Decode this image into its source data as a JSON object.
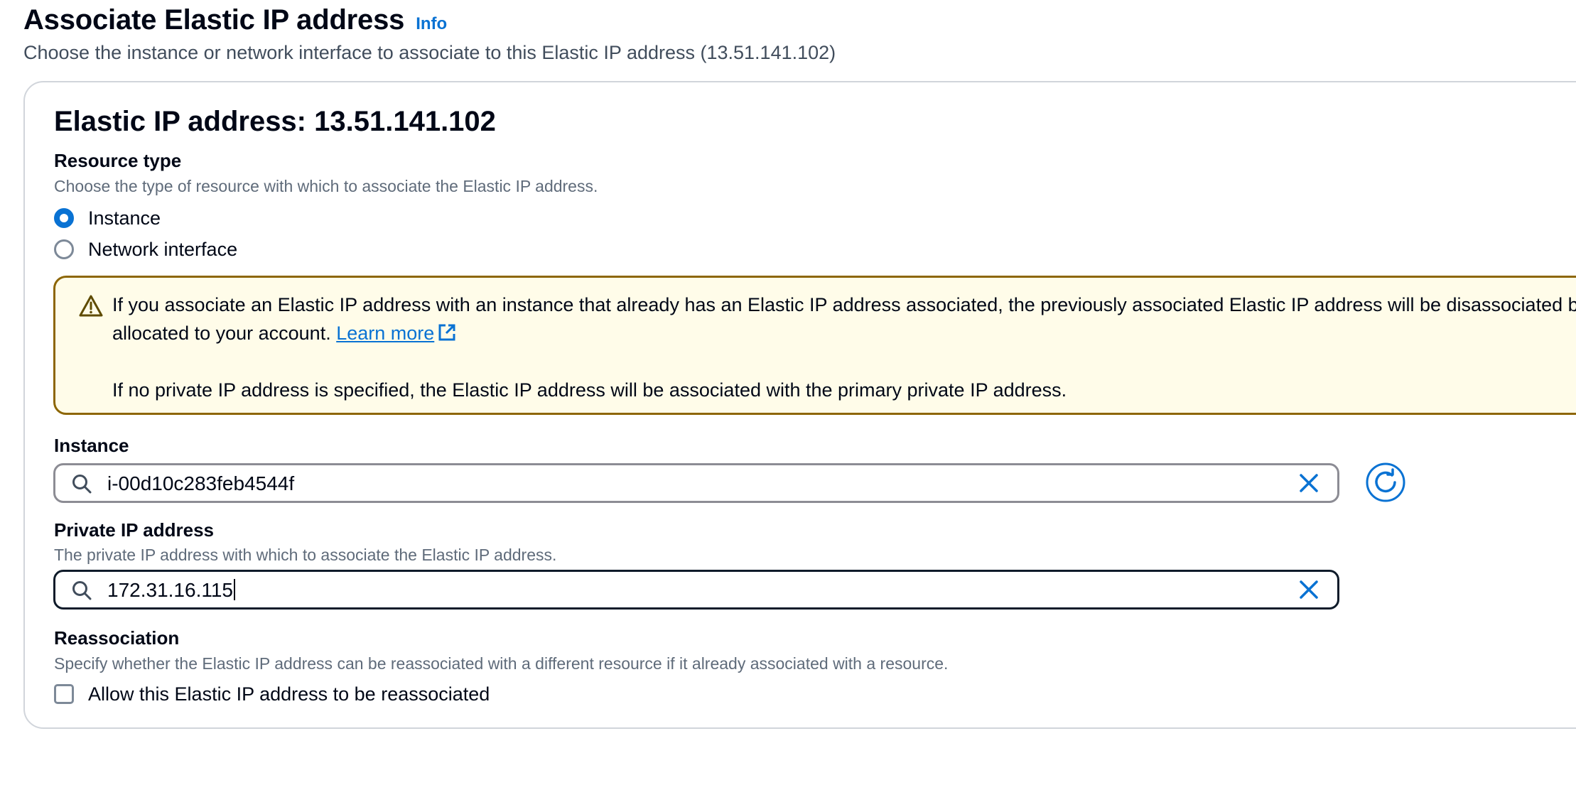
{
  "header": {
    "title": "Associate Elastic IP address",
    "info_label": "Info",
    "description": "Choose the instance or network interface to associate to this Elastic IP address (13.51.141.102)"
  },
  "card": {
    "title": "Elastic IP address: 13.51.141.102"
  },
  "resource_type": {
    "label": "Resource type",
    "description": "Choose the type of resource with which to associate the Elastic IP address.",
    "options": [
      {
        "label": "Instance",
        "selected": true
      },
      {
        "label": "Network interface",
        "selected": false
      }
    ]
  },
  "alert": {
    "line1": "If you associate an Elastic IP address with an instance that already has an Elastic IP address associated, the previously associated Elastic IP address will be disassociated but still",
    "line2_prefix": "allocated to your account. ",
    "link_label": "Learn more",
    "line3": "If no private IP address is specified, the Elastic IP address will be associated with the primary private IP address.",
    "border_color": "#8d6605",
    "background_color": "#fffce9"
  },
  "instance": {
    "label": "Instance",
    "value": "i-00d10c283feb4544f"
  },
  "private_ip": {
    "label": "Private IP address",
    "description": "The private IP address with which to associate the Elastic IP address.",
    "value": "172.31.16.115"
  },
  "reassociation": {
    "label": "Reassociation",
    "description": "Specify whether the Elastic IP address can be reassociated with a different resource if it already associated with a resource.",
    "checkbox_label": "Allow this Elastic IP address to be reassociated",
    "checked": false
  },
  "colors": {
    "accent": "#0972d3",
    "text": "#000716",
    "secondary_text": "#5f6b7a"
  },
  "icons": {
    "warning": "warning-icon",
    "external_link": "external-link-icon",
    "search": "search-icon",
    "clear": "close-icon",
    "refresh": "refresh-icon"
  }
}
